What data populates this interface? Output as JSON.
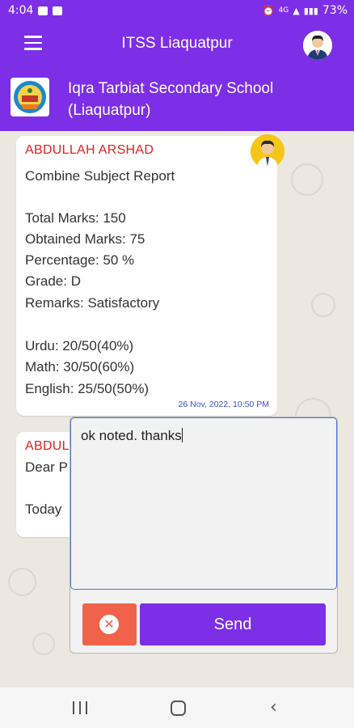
{
  "status_bar": {
    "time": "4:04",
    "network": "4G",
    "battery": "73%"
  },
  "app_bar": {
    "title": "ITSS Liaquatpur",
    "menu_icon": "hamburger-icon",
    "profile_icon": "user-avatar"
  },
  "school": {
    "name_line1": "Iqra Tarbiat Secondary School",
    "name_line2": "(Liaquatpur)"
  },
  "messages": [
    {
      "sender": "ABDULLAH ARSHAD",
      "lines": [
        "Combine Subject Report",
        "",
        "Total Marks: 150",
        "Obtained Marks: 75",
        "Percentage: 50 %",
        "Grade: D",
        "Remarks: Satisfactory",
        "",
        "Urdu: 20/50(40%)",
        "Math: 30/50(60%)",
        "English: 25/50(50%)"
      ],
      "timestamp": "26 Nov, 2022, 10:50 PM"
    },
    {
      "sender": "ABDUL",
      "lines": [
        "Dear P",
        "",
        "Today"
      ]
    }
  ],
  "reply_dialog": {
    "input_value": "ok noted. thanks",
    "cancel_icon": "close-icon",
    "send_label": "Send"
  },
  "colors": {
    "primary": "#7c2fe6",
    "sender": "#e02020",
    "timestamp": "#3b4bd8",
    "cancel": "#f0624a"
  }
}
